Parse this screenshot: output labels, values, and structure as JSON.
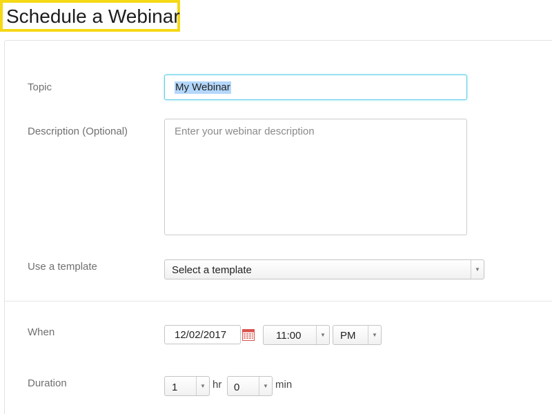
{
  "page": {
    "title": "Schedule a Webinar"
  },
  "form": {
    "topic": {
      "label": "Topic",
      "value": "My Webinar"
    },
    "description": {
      "label": "Description (Optional)",
      "placeholder": "Enter your webinar description"
    },
    "template": {
      "label": "Use a template",
      "selected": "Select a template"
    },
    "when": {
      "label": "When",
      "date": "12/02/2017",
      "time": "11:00",
      "ampm": "PM"
    },
    "duration": {
      "label": "Duration",
      "hours": "1",
      "hours_unit": "hr",
      "minutes": "0",
      "minutes_unit": "min"
    }
  },
  "icons": {
    "calendar": "calendar-icon",
    "dropdown": "chevron-down-icon"
  },
  "colors": {
    "highlight_border": "#f5d816",
    "focus_border": "#5ecde6",
    "selection": "#b4d7fb",
    "calendar_red": "#d9534f"
  }
}
